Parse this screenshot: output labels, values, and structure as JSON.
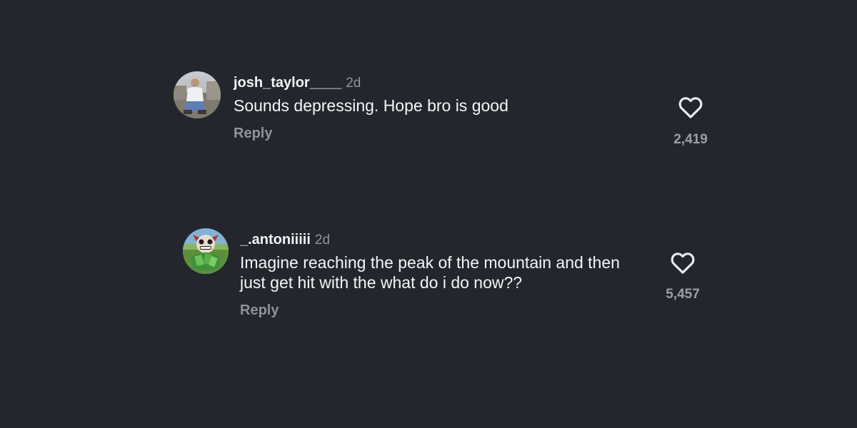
{
  "colors": {
    "background": "#23262d",
    "primary_text": "#f4f5f7",
    "secondary_text": "#8d939c"
  },
  "comments": [
    {
      "username": "josh_taylor____",
      "age": "2d",
      "text": "Sounds depressing. Hope bro is good",
      "reply_label": "Reply",
      "like_count": "2,419",
      "like_icon": "heart-outline-icon"
    },
    {
      "username": "_.antoniiiii",
      "age": "2d",
      "text": "Imagine reaching the peak of the mountain and then just get hit with the what do i do now??",
      "reply_label": "Reply",
      "like_count": "5,457",
      "like_icon": "heart-outline-icon"
    }
  ]
}
